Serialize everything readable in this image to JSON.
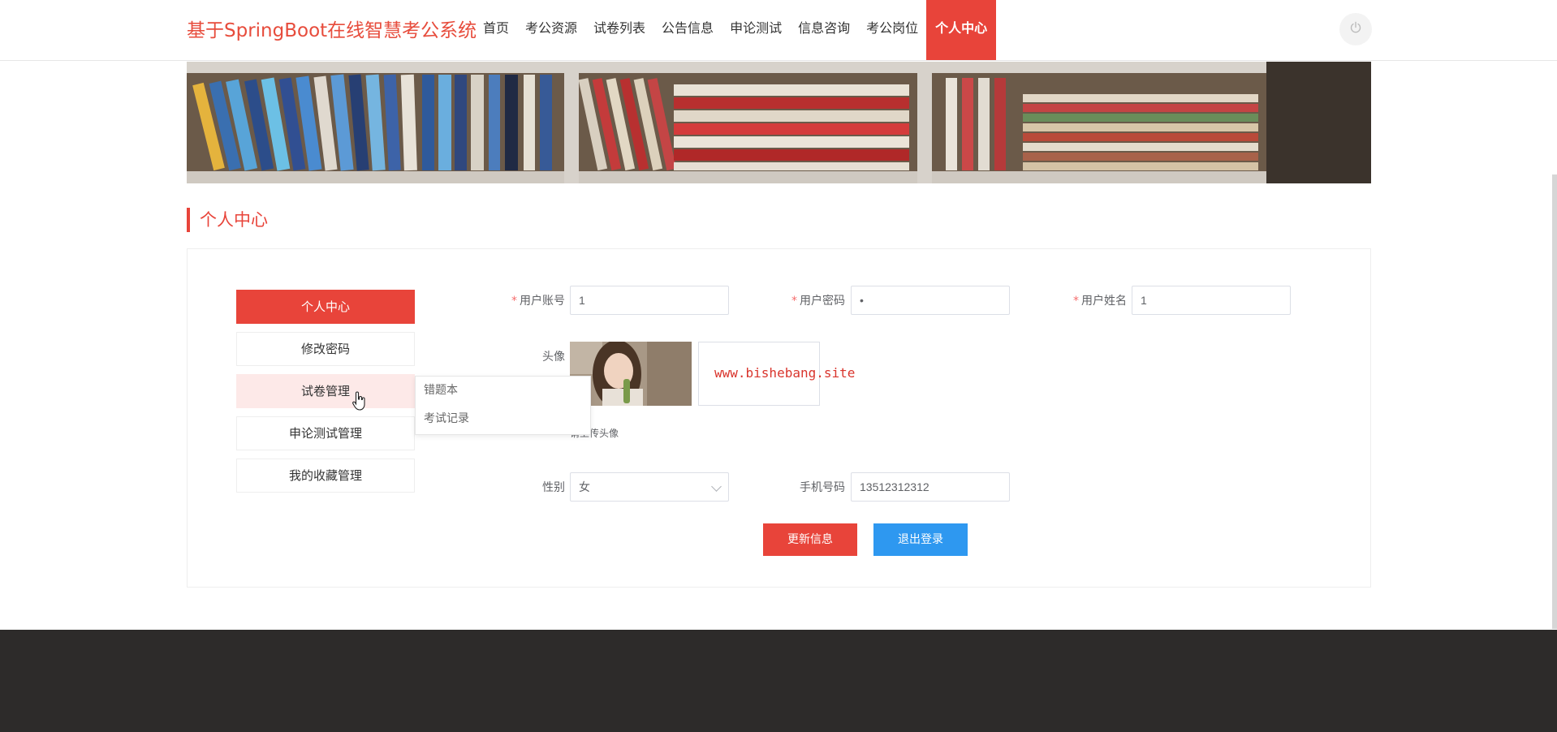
{
  "header": {
    "brand": "基于SpringBoot在线智慧考公系统",
    "nav": [
      {
        "label": "首页"
      },
      {
        "label": "考公资源"
      },
      {
        "label": "试卷列表"
      },
      {
        "label": "公告信息"
      },
      {
        "label": "申论测试"
      },
      {
        "label": "信息咨询"
      },
      {
        "label": "考公岗位"
      },
      {
        "label": "个人中心",
        "active": true
      }
    ],
    "power_icon": "power-icon"
  },
  "section": {
    "title": "个人中心"
  },
  "sidebar": {
    "items": [
      {
        "label": "个人中心",
        "state": "active"
      },
      {
        "label": "修改密码"
      },
      {
        "label": "试卷管理",
        "state": "hover"
      },
      {
        "label": "申论测试管理"
      },
      {
        "label": "我的收藏管理"
      }
    ],
    "submenu": [
      "错题本",
      "考试记录"
    ]
  },
  "form": {
    "account_label": "用户账号",
    "account_value": "1",
    "password_label": "用户密码",
    "password_value": "•",
    "name_label": "用户姓名",
    "name_value": "1",
    "avatar_label": "头像",
    "avatar_watermark": "www.bishebang.site",
    "upload_tip": "请上传头像",
    "gender_label": "性别",
    "gender_value": "女",
    "phone_label": "手机号码",
    "phone_value": "13512312312"
  },
  "buttons": {
    "update": "更新信息",
    "logout": "退出登录"
  },
  "colors": {
    "accent": "#e8443a",
    "primary_blue": "#2e98f0",
    "footer": "#2d2b2a"
  }
}
